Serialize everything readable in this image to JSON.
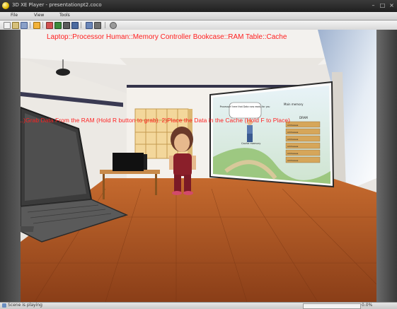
{
  "window": {
    "title": "3D XE Player - presentationpt2.coco"
  },
  "menu": [
    "File",
    "View",
    "Tools"
  ],
  "toolbar": {
    "icons": [
      "new-icon",
      "open-icon",
      "save-icon",
      "folder-icon",
      "camera-icon",
      "chart-icon",
      "film-icon",
      "monitor-icon",
      "settings-icon",
      "gear-icon"
    ]
  },
  "scene": {
    "mapping_label": "Laptop::Processor  Human::Memory Controller  Bookcase::RAM  Table::Cache",
    "instruction": "1.)Grab Data From the RAM (Hold R button to grab). 2)Place the Data in the Cache (Hold F to Place)"
  },
  "board": {
    "bubble_text": "Processor! here that Data now ready for you",
    "main_memory_label": "Main memory",
    "dram_label": "DRAM",
    "cache_label": "Cache memory",
    "addresses": [
      "Addresses",
      "Addresses",
      "Addresses",
      "Addresses",
      "Addresses",
      "Addresses"
    ]
  },
  "status": {
    "text": "Scene is playing",
    "progress": 0.0,
    "zoom": "0.0%"
  },
  "colors": {
    "overlay_text": "#ff2020",
    "floor": "#b25a26",
    "sky": "#c7d3e6"
  }
}
